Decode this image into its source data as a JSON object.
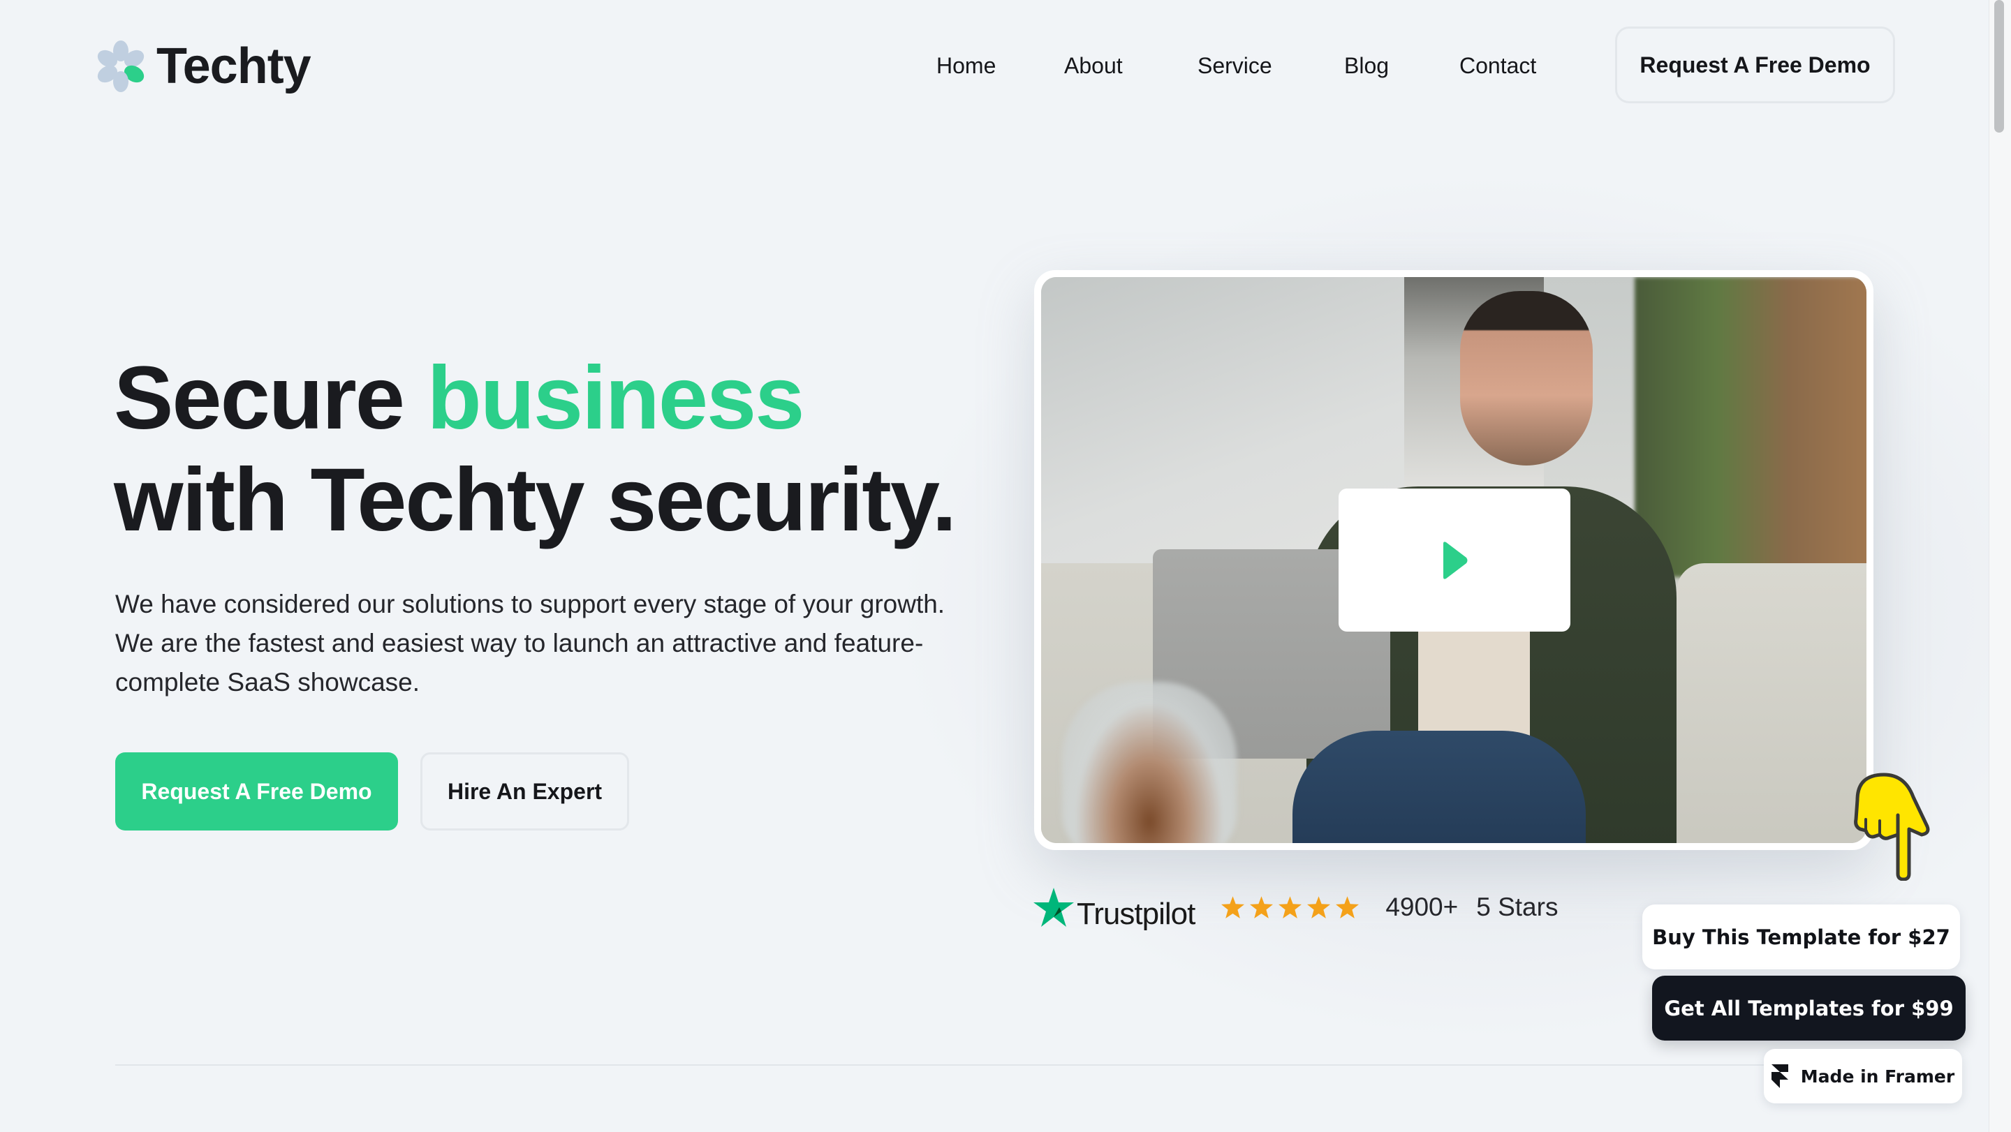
{
  "brand": {
    "name": "Techty",
    "logo_icon": "flower-petals-icon",
    "accent_color": "#2ccf8a",
    "petal_color": "#c0cfe0"
  },
  "nav": {
    "items": [
      {
        "label": "Home"
      },
      {
        "label": "About"
      },
      {
        "label": "Service"
      },
      {
        "label": "Blog"
      },
      {
        "label": "Contact"
      }
    ],
    "cta_label": "Request A Free Demo"
  },
  "hero": {
    "title_part1": "Secure ",
    "title_accent": "business",
    "title_line2": "with Techty security.",
    "description": "We have considered our solutions to support every stage of your growth. We are the fastest and easiest way to launch an attractive and feature-complete SaaS showcase.",
    "primary_button": "Request A Free Demo",
    "secondary_button": "Hire An Expert"
  },
  "video": {
    "play_icon": "play-icon",
    "play_color": "#2ccf8a"
  },
  "trust": {
    "provider": "Trustpilot",
    "provider_color": "#00b67a",
    "stars": 5,
    "star_color": "#f4a11a",
    "count": "4900+",
    "label": "5 Stars"
  },
  "floating": {
    "buy_label": "Buy This Template for $27",
    "all_label": "Get All Templates for $99",
    "framer_label": "Made in Framer",
    "cursor_icon": "pointing-hand-icon"
  }
}
